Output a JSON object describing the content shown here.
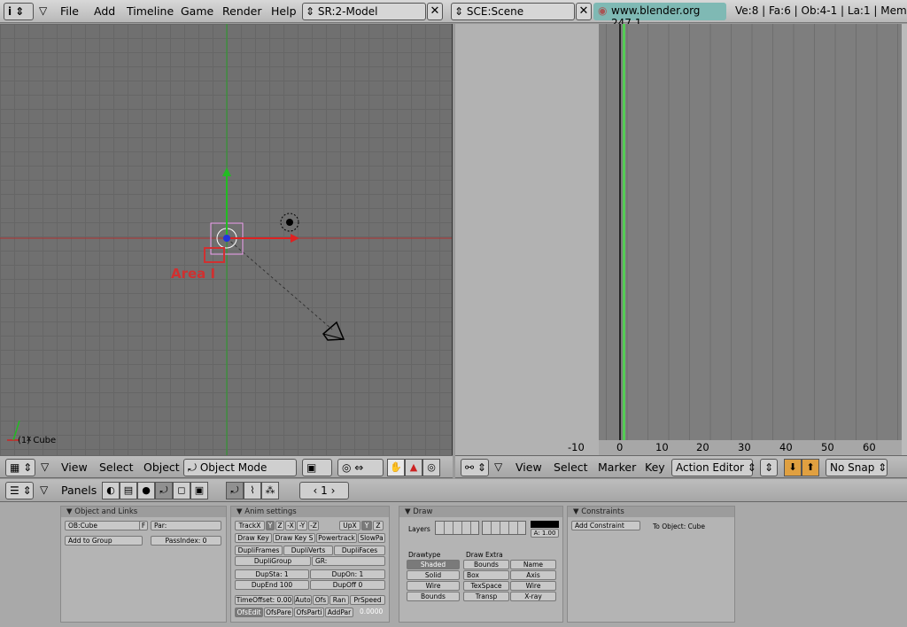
{
  "topbar": {
    "menus": [
      "File",
      "Add",
      "Timeline",
      "Game",
      "Render",
      "Help"
    ],
    "screen": "SR:2-Model",
    "scene": "SCE:Scene",
    "url": "www.blender.org 247.1",
    "stats": "Ve:8 | Fa:6 | Ob:4-1 | La:1 | Mem"
  },
  "view3d": {
    "object_label": "(1) Cube",
    "area_label": "Area I",
    "menus": [
      "View",
      "Select",
      "Object"
    ],
    "mode": "Object Mode"
  },
  "action": {
    "menus": [
      "View",
      "Select",
      "Marker",
      "Key"
    ],
    "editor": "Action Editor",
    "snap": "No Snap",
    "ticks": [
      "-10",
      "0",
      "10",
      "20",
      "30",
      "40",
      "50",
      "60"
    ]
  },
  "buttons": {
    "panels_label": "Panels",
    "frame": "1",
    "obj_links": {
      "title": "Object and Links",
      "ob": "OB:Cube",
      "f": "F",
      "par": "Par:",
      "add_group": "Add to Group",
      "pass": "PassIndex: 0"
    },
    "anim": {
      "title": "Anim settings",
      "trackx": "TrackX",
      "y": "Y",
      "z": "Z",
      "nx": "-X",
      "ny": "-Y",
      "nz": "-Z",
      "upx": "UpX",
      "uy": "Y",
      "uz": "Z",
      "drawkey": "Draw Key",
      "drawkeys": "Draw Key S",
      "powertrack": "Powertrack",
      "slowpa": "SlowPa",
      "dupliframes": "DupliFrames",
      "dupliverts": "DupliVerts",
      "duplifaces": "DupliFaces",
      "dupligroup": "DupliGroup",
      "gr": "GR:",
      "dupsta": "DupSta: 1",
      "dupon": "DupOn: 1",
      "dupend": "DupEnd 100",
      "dupoff": "DupOff 0",
      "timeoffset": "TimeOffset: 0.00",
      "auto": "Auto",
      "ofs": "Ofs",
      "ran": "Ran",
      "prspeed": "PrSpeed",
      "ofsedit": "OfsEdit",
      "ofspare": "OfsPare",
      "ofsparti": "OfsParti",
      "addpar": "AddPar",
      "val": "0.0000"
    },
    "draw": {
      "title": "Draw",
      "layers": "Layers",
      "alpha": "A: 1.00",
      "drawtype": "Drawtype",
      "drawextra": "Draw Extra",
      "shaded": "Shaded",
      "solid": "Solid",
      "wire": "Wire",
      "bounds": "Bounds",
      "x_bounds": "Bounds",
      "x_name": "Name",
      "x_box": "Box",
      "x_axis": "Axis",
      "x_texspace": "TexSpace",
      "x_wire": "Wire",
      "x_transp": "Transp",
      "x_xray": "X-ray"
    },
    "constraints": {
      "title": "Constraints",
      "add": "Add Constraint",
      "to": "To Object: Cube"
    }
  },
  "colors": {
    "x_axis": "#cc2222",
    "y_axis": "#22bb22",
    "url_bg": "#7fb9b4",
    "area_label": "#d03030"
  }
}
